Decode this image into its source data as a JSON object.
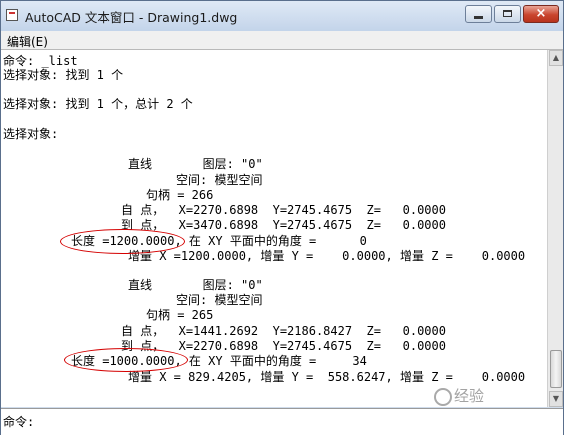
{
  "window": {
    "title": "AutoCAD 文本窗口 - Drawing1.dwg",
    "controls": {
      "close": "×"
    }
  },
  "menu": {
    "items": [
      "编辑(E)"
    ]
  },
  "text_area": {
    "lines": [
      "命令: _list",
      "选择对象: 找到 1 个",
      "选择对象: 找到 1 个，总计 2 个",
      "选择对象:",
      "直线       图层: \"0\"",
      "空间: 模型空间",
      "句柄 = 266",
      "自 点，  X=2270.6898  Y=2745.4675  Z=   0.0000",
      "到 点，  X=3470.6898  Y=2745.4675  Z=   0.0000",
      "长度 =1200.0000, 在 XY 平面中的角度 =      0",
      "增量 X =1200.0000, 增量 Y =    0.0000, 增量 Z =    0.0000",
      "直线       图层: \"0\"",
      "空间: 模型空间",
      "句柄 = 265",
      "自 点，  X=1441.2692  Y=2186.8427  Z=   0.0000",
      "到 点，  X=2270.6898  Y=2745.4675  Z=   0.0000",
      "长度 =1000.0000, 在 XY 平面中的角度 =     34",
      "增量 X = 829.4205, 增量 Y =  558.6247, 增量 Z =    0.0000"
    ]
  },
  "command_line": {
    "prompt": "命令:"
  },
  "watermark": {
    "text": "经验"
  },
  "colors": {
    "annotation": "#d40000"
  }
}
